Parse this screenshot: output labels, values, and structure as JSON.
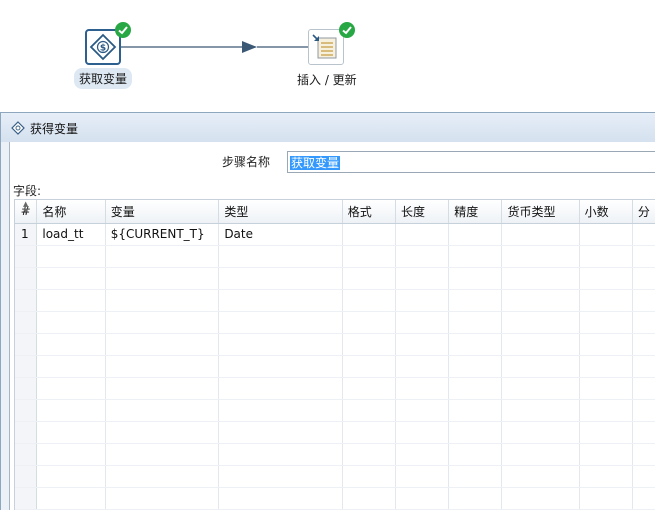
{
  "canvas": {
    "nodes": [
      {
        "label": "获取变量",
        "icon": "get-variables-icon",
        "status": "success"
      },
      {
        "label": "插入 / 更新",
        "icon": "insert-update-icon",
        "status": "success"
      }
    ],
    "colors": {
      "success": "#27a844",
      "hop": "#3b5875",
      "selected_border": "#2d5f8f"
    }
  },
  "dialog": {
    "title": "获得变量",
    "stepname_label": "步骤名称",
    "stepname_value": "获取变量",
    "fields_label": "字段:",
    "columns": [
      "#",
      "名称",
      "变量",
      "类型",
      "格式",
      "长度",
      "精度",
      "货币类型",
      "小数",
      "分"
    ],
    "rows": [
      [
        "1",
        "load_tt",
        "${CURRENT_T}",
        "Date",
        "",
        "",
        "",
        "",
        "",
        ""
      ]
    ]
  }
}
